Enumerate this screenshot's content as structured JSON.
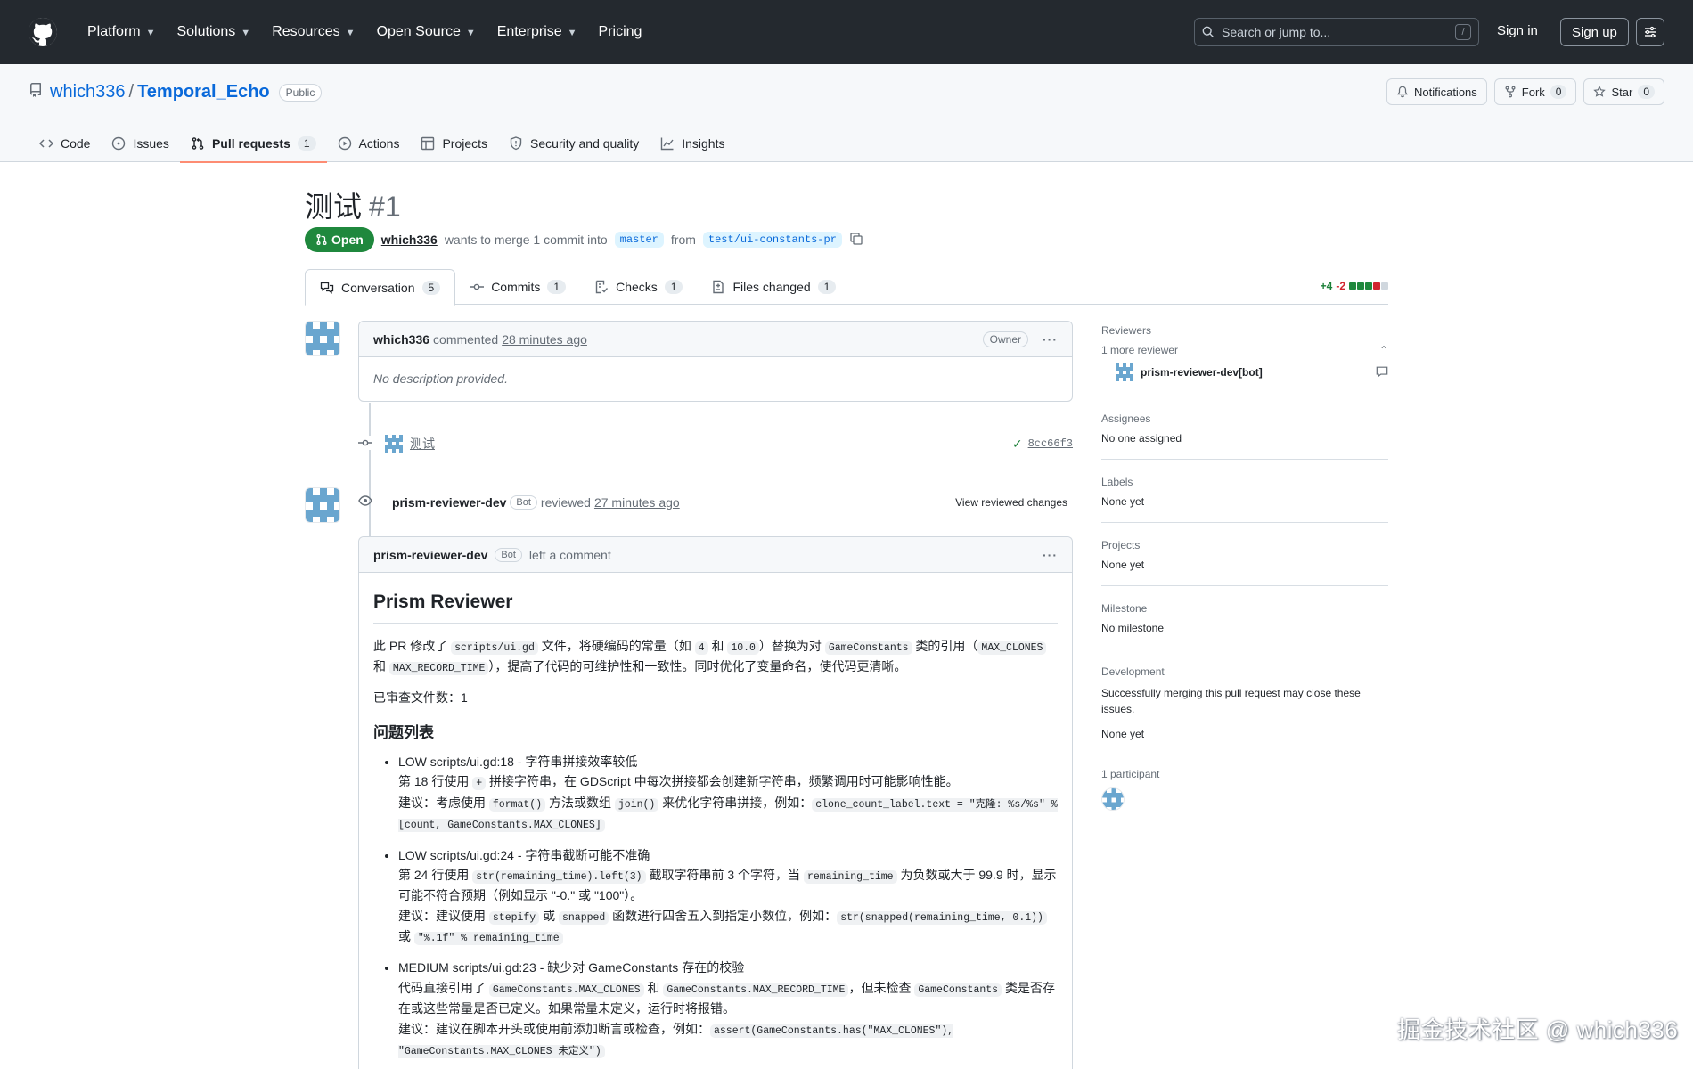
{
  "header": {
    "nav": [
      {
        "label": "Platform",
        "has_menu": true
      },
      {
        "label": "Solutions",
        "has_menu": true
      },
      {
        "label": "Resources",
        "has_menu": true
      },
      {
        "label": "Open Source",
        "has_menu": true
      },
      {
        "label": "Enterprise",
        "has_menu": true
      },
      {
        "label": "Pricing",
        "has_menu": false
      }
    ],
    "search_placeholder": "Search or jump to...",
    "search_shortcut": "/",
    "sign_in": "Sign in",
    "sign_up": "Sign up"
  },
  "repo": {
    "owner": "which336",
    "separator": "/",
    "name": "Temporal_Echo",
    "visibility": "Public",
    "notifications_label": "Notifications",
    "fork_label": "Fork",
    "fork_count": "0",
    "star_label": "Star",
    "star_count": "0",
    "tabs": [
      {
        "label": "Code",
        "icon": "code-icon",
        "count": ""
      },
      {
        "label": "Issues",
        "icon": "issue-icon",
        "count": ""
      },
      {
        "label": "Pull requests",
        "icon": "pull-request-icon",
        "count": "1",
        "active": true
      },
      {
        "label": "Actions",
        "icon": "play-icon",
        "count": ""
      },
      {
        "label": "Projects",
        "icon": "table-icon",
        "count": ""
      },
      {
        "label": "Security and quality",
        "icon": "shield-icon",
        "count": ""
      },
      {
        "label": "Insights",
        "icon": "graph-icon",
        "count": ""
      }
    ]
  },
  "pr": {
    "title": "测试",
    "number": "#1",
    "state": "Open",
    "author": "which336",
    "merge_text": "wants to merge 1 commit into",
    "base_branch": "master",
    "from_text": "from",
    "head_branch": "test/ui-constants-pr",
    "tabs": [
      {
        "label": "Conversation",
        "count": "5",
        "icon": "comment-discussion-icon",
        "active": true
      },
      {
        "label": "Commits",
        "count": "1",
        "icon": "commit-icon"
      },
      {
        "label": "Checks",
        "count": "1",
        "icon": "checklist-icon"
      },
      {
        "label": "Files changed",
        "count": "1",
        "icon": "file-diff-icon"
      }
    ],
    "diffstat": {
      "additions": "+4",
      "deletions": "-2"
    }
  },
  "timeline": {
    "first_comment": {
      "author": "which336",
      "action": "commented",
      "time": "28 minutes ago",
      "role": "Owner",
      "body": "No description provided."
    },
    "commit": {
      "message": "测试",
      "sha": "8cc66f3"
    },
    "review": {
      "author": "prism-reviewer-dev",
      "badge": "Bot",
      "action": "reviewed",
      "time": "27 minutes ago",
      "view_label": "View reviewed changes"
    },
    "bot_comment": {
      "author": "prism-reviewer-dev",
      "badge": "Bot",
      "action": "left a comment",
      "heading": "Prism Reviewer",
      "summary": {
        "t1": "此 PR 修改了 ",
        "c1": "scripts/ui.gd",
        "t2": " 文件，将硬编码的常量（如 ",
        "c2": "4",
        "t3": " 和 ",
        "c3": "10.0",
        "t4": "）替换为对 ",
        "c4": "GameConstants",
        "t5": " 类的引用（",
        "c5": "MAX_CLONES",
        "t6": " 和 ",
        "c6": "MAX_RECORD_TIME",
        "t7": "），提高了代码的可维护性和一致性。同时优化了变量命名，使代码更清晰。"
      },
      "files_reviewed": "已审查文件数：1",
      "issues_heading": "问题列表",
      "issues": [
        {
          "title": "LOW scripts/ui.gd:18 - 字符串拼接效率较低",
          "l1a": "第 18 行使用 ",
          "l1c": "+",
          "l1b": " 拼接字符串，在 GDScript 中每次拼接都会创建新字符串，频繁调用时可能影响性能。",
          "l2a": "建议：考虑使用 ",
          "l2c1": "format()",
          "l2b": " 方法或数组 ",
          "l2c2": "join()",
          "l2d": " 来优化字符串拼接，例如：",
          "l2c3": "clone_count_label.text = \"克隆: %s/%s\" % [count, GameConstants.MAX_CLONES]"
        },
        {
          "title": "LOW scripts/ui.gd:24 - 字符串截断可能不准确",
          "l1a": "第 24 行使用 ",
          "l1c": "str(remaining_time).left(3)",
          "l1b": " 截取字符串前 3 个字符，当 ",
          "l1c2": "remaining_time",
          "l1d": " 为负数或大于 99.9 时，显示可能不符合预期（例如显示 \"-0.\" 或 \"100\"）。",
          "l2a": "建议：建议使用 ",
          "l2c1": "stepify",
          "l2b": " 或 ",
          "l2c2": "snapped",
          "l2d": " 函数进行四舍五入到指定小数位，例如：",
          "l2c3": "str(snapped(remaining_time, 0.1))",
          "l2e": " 或 ",
          "l2c4": "\"%.1f\" % remaining_time"
        },
        {
          "title": "MEDIUM scripts/ui.gd:23 - 缺少对 GameConstants 存在的校验",
          "l1a": "代码直接引用了 ",
          "l1c": "GameConstants.MAX_CLONES",
          "l1b": " 和 ",
          "l1c2": "GameConstants.MAX_RECORD_TIME",
          "l1d": "，但未检查 ",
          "l1c3": "GameConstants",
          "l1e": " 类是否存在或这些常量是否已定义。如果常量未定义，运行时将报错。",
          "l2a": "建议：建议在脚本开头或使用前添加断言或检查，例如：",
          "l2c1": "assert(GameConstants.has(\"MAX_CLONES\"), \"GameConstants.MAX_CLONES 未定义\")"
        }
      ]
    }
  },
  "sidebar": {
    "reviewers_title": "Reviewers",
    "more_reviewer": "1 more reviewer",
    "reviewer_name": "prism-reviewer-dev[bot]",
    "assignees_title": "Assignees",
    "assignees_value": "No one assigned",
    "labels_title": "Labels",
    "labels_value": "None yet",
    "projects_title": "Projects",
    "projects_value": "None yet",
    "milestone_title": "Milestone",
    "milestone_value": "No milestone",
    "development_title": "Development",
    "development_text": "Successfully merging this pull request may close these issues.",
    "development_value": "None yet",
    "participants_title": "1 participant"
  },
  "watermark": "掘金技术社区 @ which336",
  "colors": {
    "header_bg": "#24292f",
    "open_green": "#1f883d",
    "link_blue": "#0969da",
    "tab_underline": "#fd8c73",
    "identicon": "#6aa6cf"
  }
}
